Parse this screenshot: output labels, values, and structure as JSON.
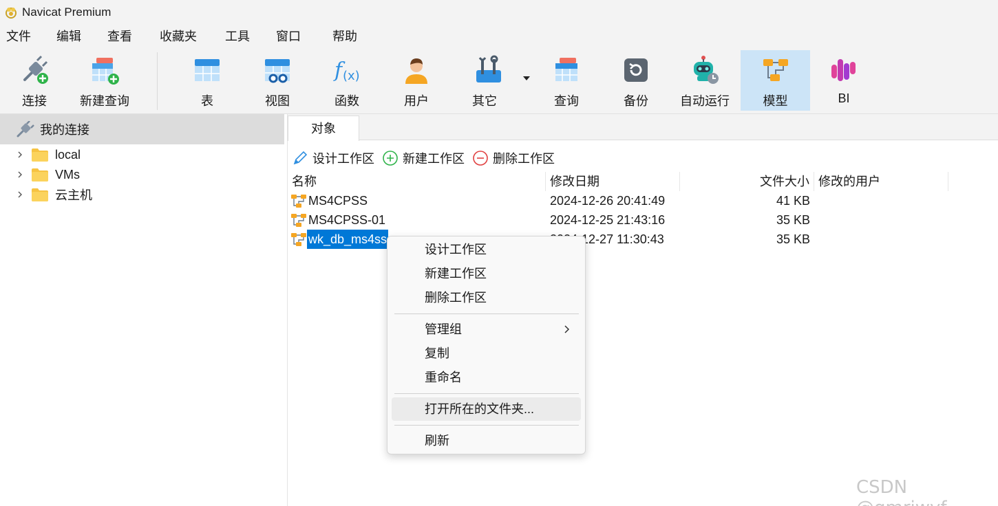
{
  "window": {
    "title": "Navicat Premium"
  },
  "menu": [
    "文件",
    "编辑",
    "查看",
    "收藏夹",
    "工具",
    "窗口",
    "帮助"
  ],
  "toolbar": {
    "connect": "连接",
    "new_query": "新建查询",
    "table": "表",
    "view": "视图",
    "function": "函数",
    "user": "用户",
    "other": "其它",
    "query": "查询",
    "backup": "备份",
    "automation": "自动运行",
    "model": "模型",
    "bi": "BI"
  },
  "sidebar": {
    "header": "我的连接",
    "items": [
      "local",
      "VMs",
      "云主机"
    ]
  },
  "tabs": {
    "objects": "对象"
  },
  "actions": {
    "design": "设计工作区",
    "new": "新建工作区",
    "delete": "删除工作区"
  },
  "table": {
    "columns": [
      "名称",
      "修改日期",
      "文件大小",
      "修改的用户"
    ],
    "rows": [
      {
        "name": "MS4CPSS",
        "date": "2024-12-26 20:41:49",
        "size": "41 KB",
        "user": ""
      },
      {
        "name": "MS4CPSS-01",
        "date": "2024-12-25 21:43:16",
        "size": "35 KB",
        "user": ""
      },
      {
        "name": "wk_db_ms4ss",
        "date": "2024-12-27 11:30:43",
        "size": "35 KB",
        "user": ""
      }
    ]
  },
  "context_menu": {
    "design": "设计工作区",
    "new": "新建工作区",
    "delete": "删除工作区",
    "manage_group": "管理组",
    "copy": "复制",
    "rename": "重命名",
    "open_folder": "打开所在的文件夹...",
    "refresh": "刷新"
  },
  "watermark": "CSDN @gmriwyf",
  "colors": {
    "selection": "#0078d7",
    "active_tool": "#cce4f7",
    "folder": "#f6c343",
    "model_orange": "#f5a623"
  }
}
